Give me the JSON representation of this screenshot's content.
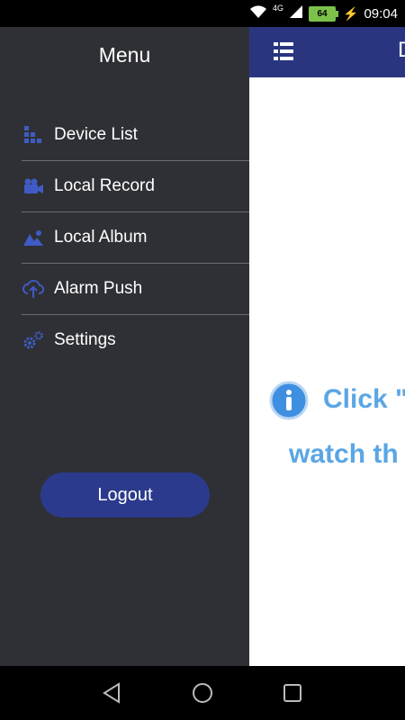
{
  "status_bar": {
    "network": "4G",
    "battery": "64",
    "time": "09:04"
  },
  "drawer": {
    "title": "Menu",
    "items": [
      {
        "label": "Device List",
        "icon": "device-list-icon"
      },
      {
        "label": "Local Record",
        "icon": "video-camera-icon"
      },
      {
        "label": "Local Album",
        "icon": "image-icon"
      },
      {
        "label": "Alarm Push",
        "icon": "cloud-upload-icon"
      },
      {
        "label": "Settings",
        "icon": "gears-icon"
      }
    ],
    "logout_label": "Logout"
  },
  "main": {
    "header_title": "D",
    "hint_line1": "Click \"",
    "hint_line2": "watch th"
  },
  "colors": {
    "drawer_bg": "#2f3035",
    "accent": "#2b3a8c",
    "icon_blue": "#3f5bc4",
    "hint_blue": "#5aa6e5"
  }
}
